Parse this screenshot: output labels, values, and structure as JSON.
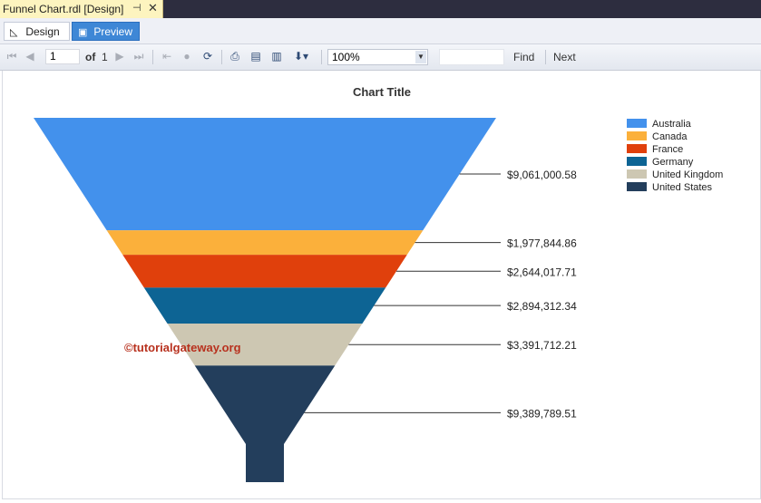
{
  "document_tab": {
    "title": "Funnel Chart.rdl [Design]",
    "pin_icon": "pin-icon",
    "close_icon": "close-icon"
  },
  "mode_tabs": [
    {
      "label": "Design",
      "icon": "design-icon",
      "active": false
    },
    {
      "label": "Preview",
      "icon": "preview-icon",
      "active": true
    }
  ],
  "toolbar": {
    "page_value": "1",
    "of_label": "of",
    "total_pages": "1",
    "zoom_value": "100%",
    "find_label": "Find",
    "next_label": "Next"
  },
  "watermark": "©tutorialgateway.org",
  "colors": {
    "Australia": "#4391ec",
    "Canada": "#fbb03b",
    "France": "#e0400c",
    "Germany": "#0d6494",
    "United Kingdom": "#cdc7b2",
    "United States": "#233e5c"
  },
  "chart_data": {
    "type": "funnel",
    "title": "Chart Title",
    "categories": [
      "Australia",
      "Canada",
      "France",
      "Germany",
      "United Kingdom",
      "United States"
    ],
    "values": [
      9061000.58,
      1977844.86,
      2644017.71,
      2894312.34,
      3391712.21,
      9389789.51
    ],
    "labels": [
      "$9,061,000.58",
      "$1,977,844.86",
      "$2,644,017.71",
      "$2,894,312.34",
      "$3,391,712.21",
      "$9,389,789.51"
    ],
    "legend_position": "top-right"
  }
}
